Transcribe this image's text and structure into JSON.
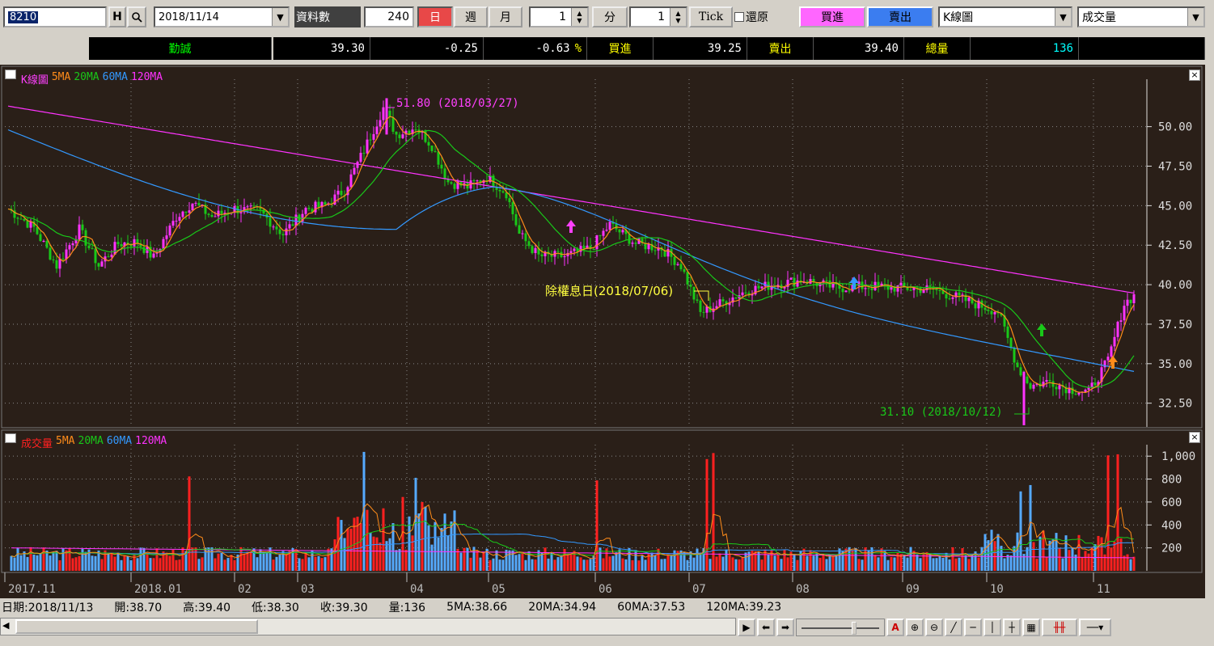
{
  "toolbar": {
    "symbol": "8210",
    "h_btn": "H",
    "date": "2018/11/14",
    "data_count_label": "資料數",
    "data_count": "240",
    "tabs": [
      "日",
      "週",
      "月"
    ],
    "period_value": "1",
    "minute_label": "分",
    "tick_value": "1",
    "tick_label": "Tick",
    "restore_label": "還原",
    "buy_label": "買進",
    "sell_label": "賣出",
    "chart_type": "K線圖",
    "indicator": "成交量"
  },
  "quote": {
    "name": "勤誠",
    "price": "39.30",
    "change": "-0.25",
    "change_pct": "-0.63",
    "pct_sign": "%",
    "bid_label": "買進",
    "bid": "39.25",
    "ask_label": "賣出",
    "ask": "39.40",
    "volume_label": "總量",
    "volume": "136"
  },
  "price_panel": {
    "legend": [
      "K線圖",
      "5MA",
      "20MA",
      "60MA",
      "120MA"
    ],
    "legend_colors": [
      "#ff40ff",
      "#ff8c1a",
      "#19c819",
      "#3399ff",
      "#ff33ff"
    ],
    "high_annotation": "51.80 (2018/03/27)",
    "low_annotation": "31.10 (2018/10/12)",
    "ex_div_annotation": "除權息日(2018/07/06)",
    "y_ticks": [
      "50.00",
      "47.50",
      "45.00",
      "42.50",
      "40.00",
      "37.50",
      "35.00",
      "32.50"
    ]
  },
  "volume_panel": {
    "legend": [
      "成交量",
      "5MA",
      "20MA",
      "60MA",
      "120MA"
    ],
    "legend_colors": [
      "#ff2020",
      "#ff8c1a",
      "#19c819",
      "#3399ff",
      "#ff33ff"
    ],
    "y_ticks": [
      "1,000",
      "800",
      "600",
      "400",
      "200"
    ]
  },
  "x_labels": [
    "2017.11",
    "2018.01",
    "02",
    "03",
    "04",
    "05",
    "06",
    "07",
    "08",
    "09",
    "10",
    "11"
  ],
  "status": {
    "date": "日期:2018/11/13",
    "open": "開:38.70",
    "high": "高:39.40",
    "low": "低:38.30",
    "close": "收:39.30",
    "vol": "量:136",
    "ma5": "5MA:38.66",
    "ma20": "20MA:34.94",
    "ma60": "60MA:37.53",
    "ma120": "120MA:39.23"
  },
  "chart_data": {
    "type": "line",
    "title": "",
    "y_range": [
      31.0,
      53.0
    ],
    "close_approx": [
      {
        "x": "2017.11",
        "y": 44.8
      },
      {
        "x": "2017.12",
        "y": 41.5
      },
      {
        "x": "2018.01",
        "y": 44.5
      },
      {
        "x": "2018.02",
        "y": 43.5
      },
      {
        "x": "2018.03",
        "y": 46.0
      },
      {
        "x": "2018.03 late",
        "y": 51.8
      },
      {
        "x": "2018.04",
        "y": 48.5
      },
      {
        "x": "2018.05",
        "y": 45.5
      },
      {
        "x": "2018.06",
        "y": 42.0
      },
      {
        "x": "2018.07",
        "y": 38.2
      },
      {
        "x": "2018.08",
        "y": 40.0
      },
      {
        "x": "2018.09",
        "y": 39.8
      },
      {
        "x": "2018.10",
        "y": 33.5
      },
      {
        "x": "2018.11",
        "y": 39.3
      }
    ],
    "volume_y_range": [
      0,
      1100
    ]
  }
}
